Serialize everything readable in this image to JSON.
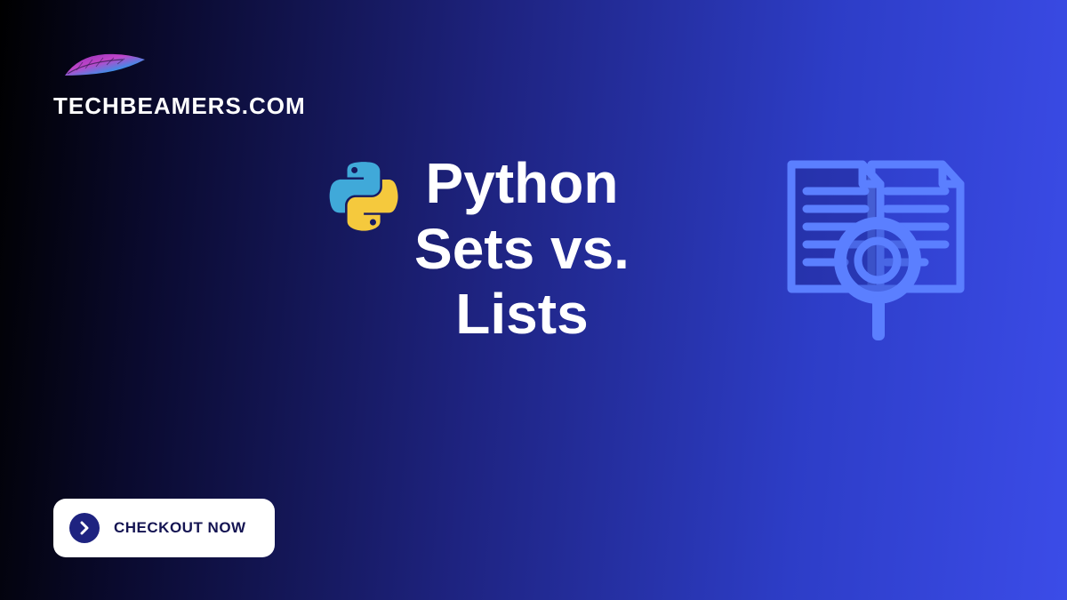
{
  "logo": {
    "brand_text": "TECHBEAMERS.COM"
  },
  "hero": {
    "title": "Python\nSets vs.\nLists"
  },
  "cta": {
    "label": "CHECKOUT NOW"
  }
}
